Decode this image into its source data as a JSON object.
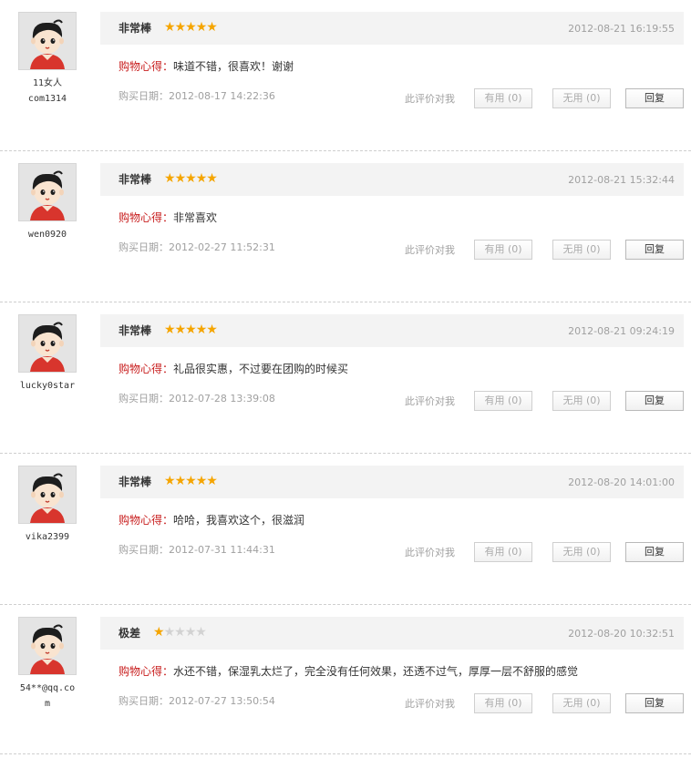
{
  "labels": {
    "experience": "购物心得：",
    "buy_date": "购买日期：",
    "useful_question": "此评价对我",
    "useful": "有用",
    "useless": "无用",
    "reply": "回复"
  },
  "colors": {
    "star_on": "#f5a500",
    "star_off": "#d2d2d2",
    "experience_tag": "#c81e1e"
  },
  "reviews": [
    {
      "user_line1": "11女人",
      "user_line2": "com1314",
      "rating_label": "非常棒",
      "rating": 5,
      "max_rating": 5,
      "date": "2012-08-21 16:19:55",
      "content": "味道不错，很喜欢！谢谢",
      "buy_date": "2012-08-17 14:22:36",
      "useful_count": "(0)",
      "useless_count": "(0)"
    },
    {
      "user_line1": "wen0920",
      "user_line2": "",
      "rating_label": "非常棒",
      "rating": 5,
      "max_rating": 5,
      "date": "2012-08-21 15:32:44",
      "content": "非常喜欢",
      "buy_date": "2012-02-27 11:52:31",
      "useful_count": "(0)",
      "useless_count": "(0)"
    },
    {
      "user_line1": "lucky0star",
      "user_line2": "",
      "rating_label": "非常棒",
      "rating": 5,
      "max_rating": 5,
      "date": "2012-08-21 09:24:19",
      "content": "礼品很实惠，不过要在团购的时候买",
      "buy_date": "2012-07-28 13:39:08",
      "useful_count": "(0)",
      "useless_count": "(0)"
    },
    {
      "user_line1": "vika2399",
      "user_line2": "",
      "rating_label": "非常棒",
      "rating": 5,
      "max_rating": 5,
      "date": "2012-08-20 14:01:00",
      "content": "哈哈，我喜欢这个，很滋润",
      "buy_date": "2012-07-31 11:44:31",
      "useful_count": "(0)",
      "useless_count": "(0)"
    },
    {
      "user_line1": "54**@qq.co",
      "user_line2": "m",
      "rating_label": "极差",
      "rating": 1,
      "max_rating": 5,
      "date": "2012-08-20 10:32:51",
      "content": "水还不错，保湿乳太烂了，完全没有任何效果，还透不过气，厚厚一层不舒服的感觉",
      "buy_date": "2012-07-27 13:50:54",
      "useful_count": "(0)",
      "useless_count": "(0)"
    }
  ]
}
